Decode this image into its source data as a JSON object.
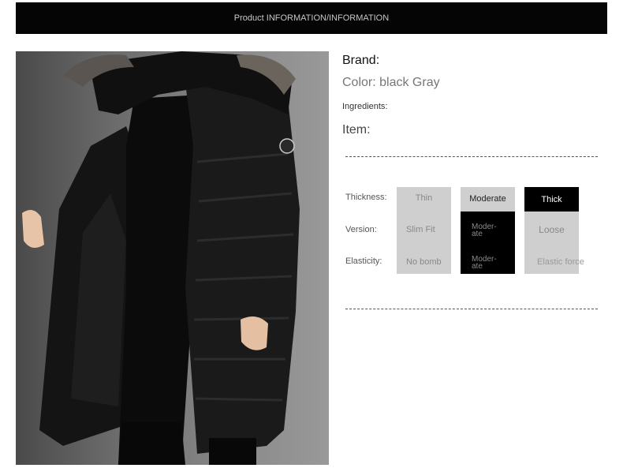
{
  "header": {
    "title": "Product INFORMATION/INFORMATION"
  },
  "info": {
    "brand": "Brand:",
    "color": "Color: black Gray",
    "ingredients": "Ingredients:",
    "item": "Item:"
  },
  "attributes": {
    "rows": [
      "Thickness:",
      "Version:",
      "Elasticity:"
    ],
    "columns": [
      {
        "cells": [
          "Thin",
          "Slim Fit",
          "No bomb"
        ]
      },
      {
        "cells": [
          "Moderate",
          "Moder-\nate",
          "Moder-\nate"
        ]
      },
      {
        "cells": [
          "Thick",
          "Loose",
          "Elastic force"
        ]
      }
    ]
  },
  "colors": {
    "header_bg": "#050505",
    "cell_gray": "#cfcfcf",
    "cell_black": "#000000"
  }
}
